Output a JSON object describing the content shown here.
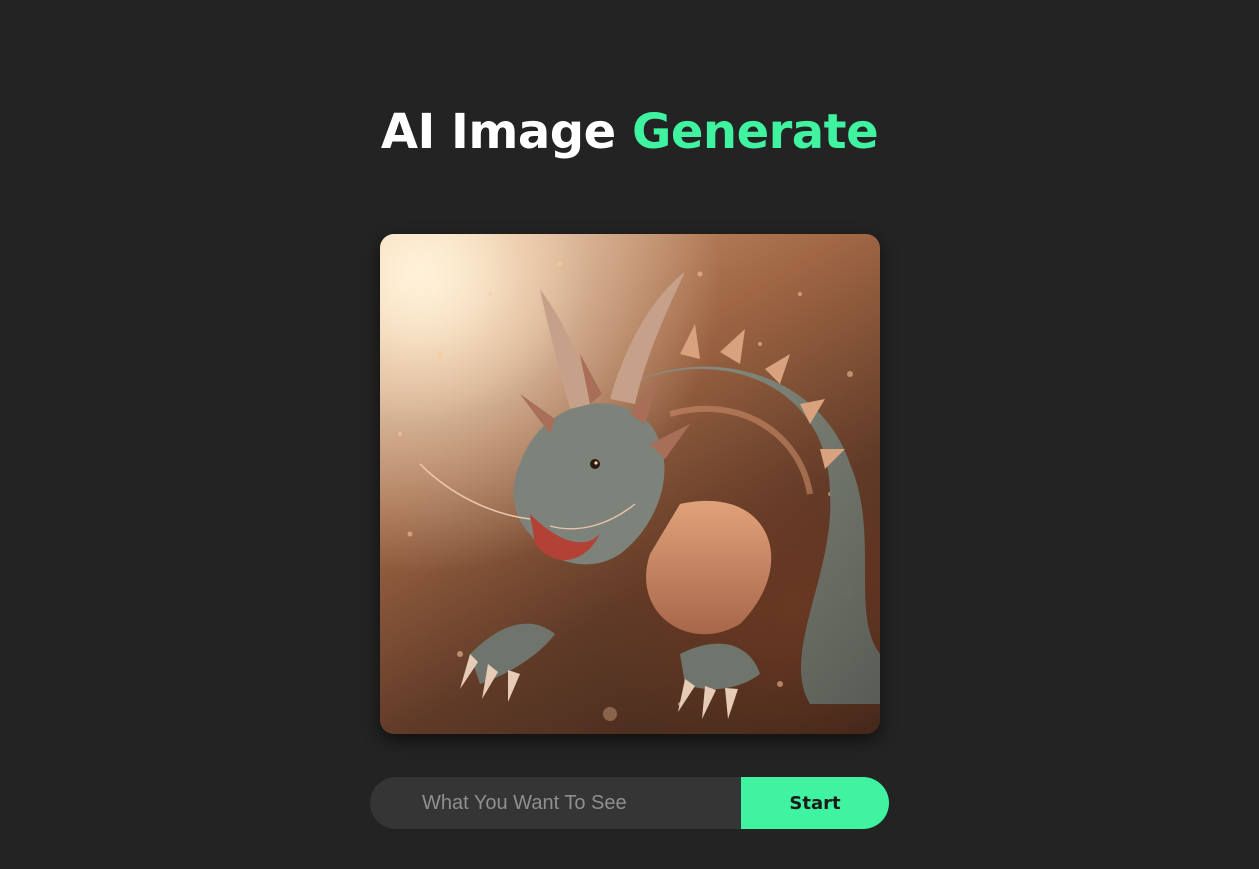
{
  "header": {
    "title_part1": "AI Image",
    "title_part2": "Generate"
  },
  "generated_image": {
    "subject": "dragon"
  },
  "prompt": {
    "placeholder": "What You Want To See",
    "value": "",
    "button_label": "Start"
  },
  "colors": {
    "background": "#232323",
    "accent": "#3ff3a0",
    "input_background": "#353535",
    "title_text": "#ffffff"
  }
}
